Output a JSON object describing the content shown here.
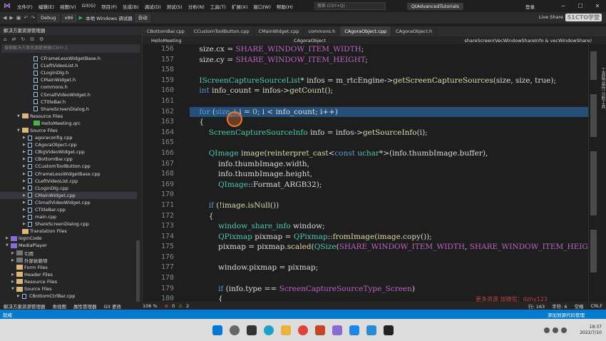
{
  "titlebar": {
    "menu": [
      "文件(F)",
      "编辑(E)",
      "视图(V)",
      "Git(G)",
      "项目(P)",
      "生成(B)",
      "调试(D)",
      "测试(S)",
      "分析(N)",
      "工具(T)",
      "扩展(X)",
      "窗口(W)",
      "帮助(H)"
    ],
    "search_placeholder": "搜索 (Ctrl+Q)",
    "project_name": "QtAdvancedTutorials",
    "login": "登录"
  },
  "toolbar": {
    "config": "Debug",
    "platform": "x86",
    "run_label": "本地 Windows 调试器",
    "auto_label": "自动",
    "live_share": "Live Share",
    "watermark": "51CTO学堂"
  },
  "solution": {
    "title": "解决方案资源管理器",
    "search_placeholder": "搜索解决方案资源管理器(Ctrl+;)",
    "items": [
      {
        "label": "CFrameLessWidgetBase.h",
        "kind": "file",
        "indent": 4
      },
      {
        "label": "CLeftVideoList.h",
        "kind": "file",
        "indent": 4
      },
      {
        "label": "CLoginDlg.h",
        "kind": "file",
        "indent": 4
      },
      {
        "label": "CMainWidget.h",
        "kind": "file",
        "indent": 4
      },
      {
        "label": "commons.h",
        "kind": "file",
        "indent": 4
      },
      {
        "label": "CSmallVideoWidget.h",
        "kind": "file",
        "indent": 4
      },
      {
        "label": "CTitleBar.h",
        "kind": "file",
        "indent": 4
      },
      {
        "label": "ShareScreenDialog.h",
        "kind": "file",
        "indent": 4
      },
      {
        "label": "Resource Files",
        "kind": "folder",
        "indent": 2,
        "arrow": "▼"
      },
      {
        "label": "HelloMeeting.qrc",
        "kind": "qrc",
        "indent": 4
      },
      {
        "label": "Source Files",
        "kind": "folder",
        "indent": 2,
        "arrow": "▼"
      },
      {
        "label": "agoraconfig.cpp",
        "kind": "file",
        "indent": 3,
        "arrow": "▶"
      },
      {
        "label": "CAgoraObject.cpp",
        "kind": "file",
        "indent": 3,
        "arrow": "▶"
      },
      {
        "label": "CBigVideoWidget.cpp",
        "kind": "file",
        "indent": 3,
        "arrow": "▶"
      },
      {
        "label": "CBottomBar.cpp",
        "kind": "file",
        "indent": 3,
        "arrow": "▶"
      },
      {
        "label": "CCustomToolButton.cpp",
        "kind": "file",
        "indent": 3,
        "arrow": "▶"
      },
      {
        "label": "CFrameLessWidgetBase.cpp",
        "kind": "file",
        "indent": 3,
        "arrow": "▶"
      },
      {
        "label": "CLeftVideoList.cpp",
        "kind": "file",
        "indent": 3,
        "arrow": "▶"
      },
      {
        "label": "CLoginDlg.cpp",
        "kind": "file",
        "indent": 3,
        "arrow": "▶"
      },
      {
        "label": "CMainWidget.cpp",
        "kind": "file",
        "indent": 3,
        "arrow": "▶",
        "selected": true
      },
      {
        "label": "CSmallVideoWidget.cpp",
        "kind": "file",
        "indent": 3,
        "arrow": "▶"
      },
      {
        "label": "CTitleBar.cpp",
        "kind": "file",
        "indent": 3,
        "arrow": "▶"
      },
      {
        "label": "main.cpp",
        "kind": "file",
        "indent": 3,
        "arrow": "▶"
      },
      {
        "label": "ShareScreenDialog.cpp",
        "kind": "file",
        "indent": 3,
        "arrow": "▶"
      },
      {
        "label": "Translation Files",
        "kind": "folder",
        "indent": 2
      },
      {
        "label": "loginCode",
        "kind": "proj",
        "indent": 0,
        "arrow": "▶"
      },
      {
        "label": "MediaPlayer",
        "kind": "proj",
        "indent": 0,
        "arrow": "▼"
      },
      {
        "label": "引用",
        "kind": "ref",
        "indent": 1,
        "arrow": "▶"
      },
      {
        "label": "外部依赖项",
        "kind": "ref",
        "indent": 1,
        "arrow": "▶"
      },
      {
        "label": "Form Files",
        "kind": "folder",
        "indent": 1
      },
      {
        "label": "Header Files",
        "kind": "folder",
        "indent": 1,
        "arrow": "▶"
      },
      {
        "label": "Resource Files",
        "kind": "folder",
        "indent": 1,
        "arrow": "▶"
      },
      {
        "label": "Source Files",
        "kind": "folder",
        "indent": 1,
        "arrow": "▼"
      },
      {
        "label": "CBottomCtrlBar.cpp",
        "kind": "file",
        "indent": 2,
        "arrow": "▶"
      }
    ]
  },
  "tabs": [
    "CBottomBar.cpp",
    "CCustomToolButton.cpp",
    "CMainWidget.cpp",
    "commons.h",
    "CAgoraObject.cpp",
    "CAgoraObject.h"
  ],
  "active_tab": 4,
  "navbar": {
    "project": "HelloMeeting",
    "scope": "CAgoraObject",
    "member": "shareScreen(VecWindowShareInfo & vecWindowShare)"
  },
  "code": {
    "line_numbers": [
      "156",
      "157",
      "158",
      "159",
      "160",
      "161",
      "162",
      "163",
      "164",
      "165",
      "166",
      "167",
      "168",
      "169",
      "170",
      "171",
      "172",
      "173",
      "174",
      "175",
      "176",
      "177",
      "178",
      "179",
      "180"
    ],
    "lines": [
      "    size.cx = SHARE_WINDOW_ITEM_WIDTH;",
      "    size.cy = SHARE_WINDOW_ITEM_HEIGHT;",
      "",
      "    IScreenCaptureSourceList* infos = m_rtcEngine->getScreenCaptureSources(size, size, true);",
      "    int info_count = infos->getCount();",
      "",
      "    for (size_t i = 0; i < info_count; i++)",
      "    {",
      "        ScreenCaptureSourceInfo info = infos->getSourceInfo(i);",
      "",
      "        QImage image(reinterpret_cast<const uchar*>(info.thumbImage.buffer),",
      "            info.thumbImage.width,",
      "            info.thumbImage.height,",
      "            QImage::Format_ARGB32);",
      "",
      "        if (!image.isNull())",
      "        {",
      "            window_share_info window;",
      "            QPixmap pixmap = QPixmap::fromImage(image.copy());",
      "            pixmap = pixmap.scaled(QSize(SHARE_WINDOW_ITEM_WIDTH, SHARE_WINDOW_ITEM_HEIGHT),",
      "",
      "            window.pixmap = pixmap;",
      "",
      "            if (info.type == ScreenCaptureSourceType_Screen)",
      "            {"
    ],
    "highlighted_line_index": 6,
    "watermark": "更多资源 加微信：dzhy123"
  },
  "right_panel": "工具箱  属性  诊断工具",
  "status_bar": {
    "left_tabs": [
      "解决方案资源管理器",
      "类视图",
      "属性管理器",
      "Git 更改"
    ],
    "zoom": "106 %",
    "errors": "0",
    "warnings": "2",
    "position": "行: 163",
    "char": "字符: 6",
    "space": "空格",
    "eol": "CRLF"
  },
  "status_bar2": {
    "ready": "就绪",
    "add_source": "添加到源代码管理"
  },
  "taskbar": {
    "time": "18:37",
    "date": "2022/7/10"
  }
}
